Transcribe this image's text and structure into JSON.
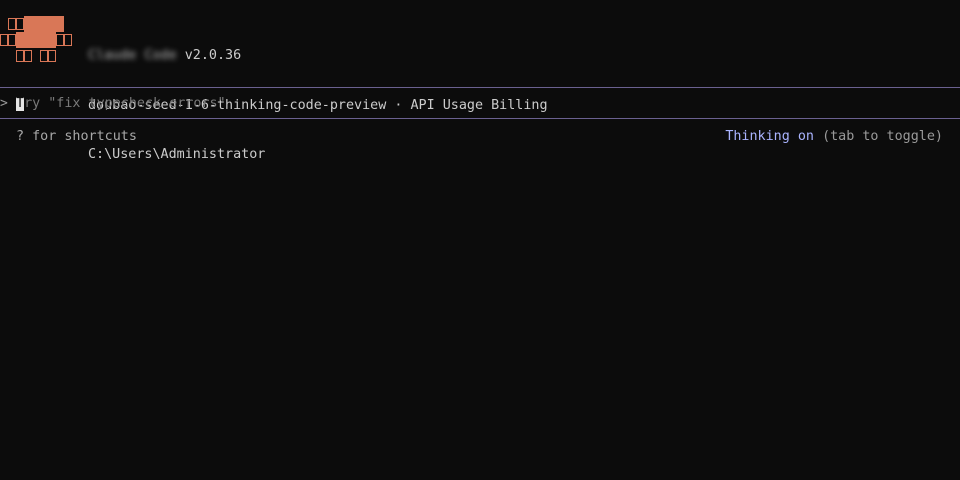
{
  "header": {
    "app_name": "Claude Code",
    "version": "v2.0.36",
    "model": "doubao-seed-1-6-thinking-code-preview",
    "separator": "·",
    "billing": "API Usage Billing",
    "cwd": "C:\\Users\\Administrator",
    "logo_color": "#d97757"
  },
  "input": {
    "prompt_icon": "chevron-right-icon",
    "placeholder_first": "T",
    "placeholder_rest": "ry \"fix typecheck errors\"",
    "border_color": "#6b6190"
  },
  "footer": {
    "shortcuts_hint": "? for shortcuts",
    "thinking_status": "Thinking on",
    "toggle_hint": "(tab to toggle)",
    "thinking_color": "#aab4ff"
  }
}
